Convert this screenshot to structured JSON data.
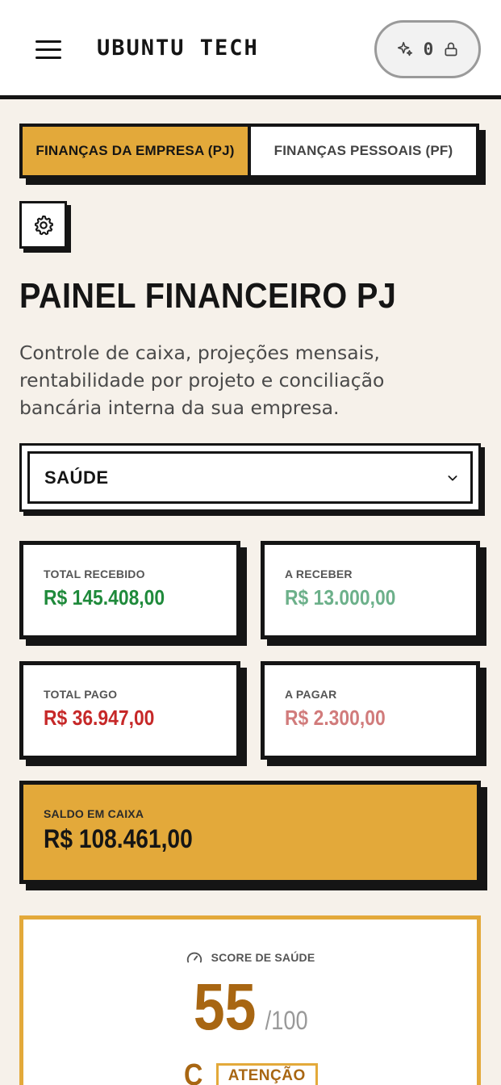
{
  "header": {
    "brand": "UBUNTU TECH",
    "credits": "0"
  },
  "tabs": [
    {
      "label": "FINANÇAS DA EMPRESA (PJ)",
      "active": true
    },
    {
      "label": "FINANÇAS PESSOAIS (PF)",
      "active": false
    }
  ],
  "page": {
    "title": "PAINEL FINANCEIRO PJ",
    "description": "Controle de caixa, projeções mensais, rentabilidade por projeto e conciliação bancária interna da sua empresa."
  },
  "select": {
    "value": "SAÚDE"
  },
  "cards": {
    "total_recebido": {
      "label": "TOTAL RECEBIDO",
      "value": "R$ 145.408,00",
      "color": "#1f8a3b"
    },
    "a_receber": {
      "label": "A RECEBER",
      "value": "R$ 13.000,00",
      "color": "#6cb08a"
    },
    "total_pago": {
      "label": "TOTAL PAGO",
      "value": "R$ 36.947,00",
      "color": "#c62828"
    },
    "a_pagar": {
      "label": "A PAGAR",
      "value": "R$ 2.300,00",
      "color": "#d17b7b"
    },
    "saldo": {
      "label": "SALDO EM CAIXA",
      "value": "R$ 108.461,00",
      "color": "#e3a93a"
    }
  },
  "score": {
    "label": "SCORE DE SAÚDE",
    "value": "55",
    "max": "/100",
    "grade": "C",
    "status": "ATENÇÃO"
  },
  "icons": {
    "menu": "hamburger-icon",
    "sparkle": "sparkle-icon",
    "lock": "lock-icon",
    "settings": "gear-icon",
    "chevron": "chevron-down-icon",
    "gauge": "gauge-icon"
  }
}
